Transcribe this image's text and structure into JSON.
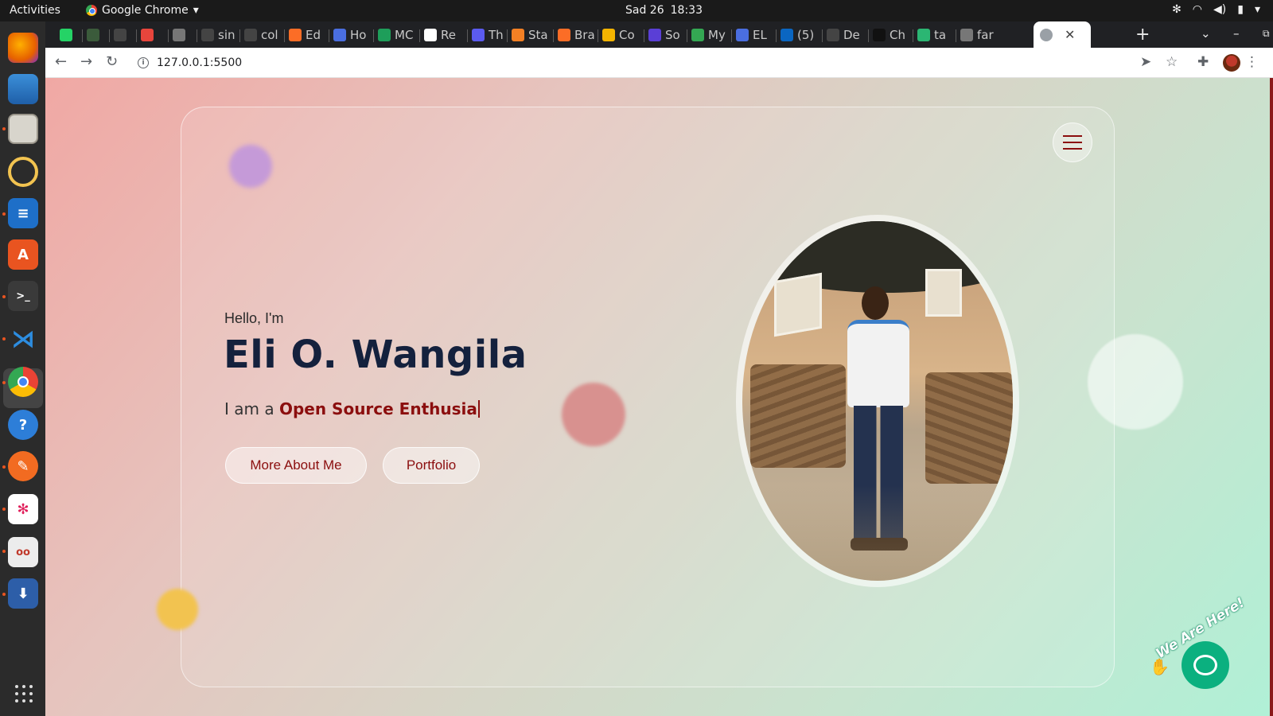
{
  "system": {
    "activities": "Activities",
    "app_name": "Google Chrome",
    "date": "Sad 26",
    "time": "18:33"
  },
  "tabs": [
    {
      "label": "",
      "icon": "whatsapp-icon",
      "color": "#25d366"
    },
    {
      "label": "",
      "icon": "tree-icon",
      "color": "#3b5b3b"
    },
    {
      "label": "",
      "icon": "github-icon",
      "color": "#444444"
    },
    {
      "label": "",
      "icon": "c-icon",
      "color": "#e8453c"
    },
    {
      "label": "",
      "icon": "globe-icon",
      "color": "#777777"
    },
    {
      "label": "sin",
      "icon": "github-icon",
      "color": "#444444"
    },
    {
      "label": "col",
      "icon": "github-icon",
      "color": "#444444"
    },
    {
      "label": "Ed",
      "icon": "gitlab-icon",
      "color": "#fc6d26"
    },
    {
      "label": "Ho",
      "icon": "docs-icon",
      "color": "#4a6ee0"
    },
    {
      "label": "MC",
      "icon": "sheets-icon",
      "color": "#1e9e5a"
    },
    {
      "label": "Re",
      "icon": "codepen-icon",
      "color": "#ffffff"
    },
    {
      "label": "Th",
      "icon": "zoom-icon",
      "color": "#5b5bf0"
    },
    {
      "label": "Sta",
      "icon": "stack-icon",
      "color": "#f48024"
    },
    {
      "label": "Bra",
      "icon": "gitlab-icon",
      "color": "#fc6d26"
    },
    {
      "label": "Co",
      "icon": "slides-icon",
      "color": "#f4b400"
    },
    {
      "label": "So",
      "icon": "bolt-icon",
      "color": "#5a3fd6"
    },
    {
      "label": "My",
      "icon": "drive-icon",
      "color": "#34a853"
    },
    {
      "label": "EL",
      "icon": "docs-icon",
      "color": "#4a6ee0"
    },
    {
      "label": "(5)",
      "icon": "linkedin-icon",
      "color": "#0a66c2"
    },
    {
      "label": "De",
      "icon": "github-icon",
      "color": "#444444"
    },
    {
      "label": "Ch",
      "icon": "ca-icon",
      "color": "#111111"
    },
    {
      "label": "ta",
      "icon": "feather-icon",
      "color": "#2bb673"
    },
    {
      "label": "far",
      "icon": "globe-icon",
      "color": "#777777"
    }
  ],
  "active_tab": {
    "icon": "globe-icon",
    "close": "✕"
  },
  "new_tab": "+",
  "address": {
    "url": "127.0.0.1:5500"
  },
  "hero": {
    "greeting": "Hello, I'm",
    "name": "Eli O. Wangila",
    "tagline_prefix": "I am a ",
    "role": "Open Source Enthusia",
    "btn_more": "More About Me",
    "btn_portfolio": "Portfolio"
  },
  "chat": {
    "label": "We Are Here!"
  }
}
